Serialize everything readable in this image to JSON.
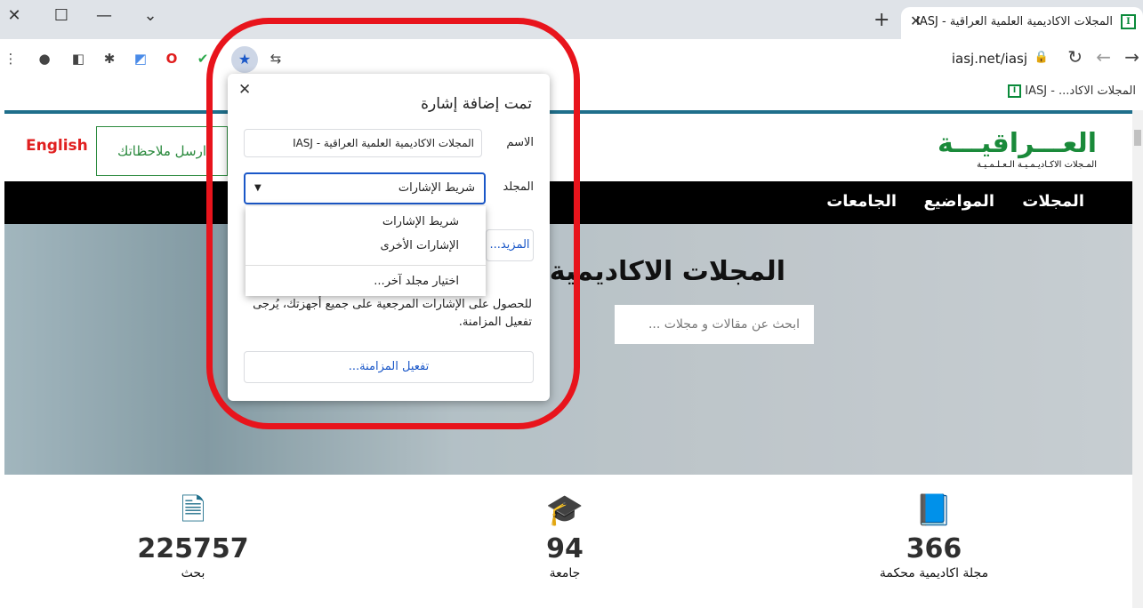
{
  "browser": {
    "tab": {
      "title": "المجلات الاكاديمية العلمية العراقية - IASJ",
      "favicon_letter": "I"
    },
    "url": "iasj.net/iasj",
    "bookmark_item": "المجلات الاكاد... - IASJ",
    "bookmark_favicon_letter": "I"
  },
  "site": {
    "logo_main": "العـــراقيـــة",
    "logo_sub": "المـجلات الاكـاديـمـيـة الـعـلـمـيـة",
    "lang_link": "English",
    "feedback_button": "ارسل ملاحظاتك",
    "nav": [
      "المجلات",
      "المواضيع",
      "الجامعات"
    ],
    "hero_title": "المجلات الاكاديمية",
    "search_placeholder": "ابحث عن مقالات و مجلات ...",
    "stats": [
      {
        "value": "225757",
        "label": "بحث",
        "icon": "document-icon"
      },
      {
        "value": "94",
        "label": "جامعة",
        "icon": "graduation-cap-icon"
      },
      {
        "value": "366",
        "label": "مجلة اكاديمية محكمة",
        "icon": "book-icon"
      }
    ]
  },
  "popup": {
    "title": "تمت إضافة إشارة",
    "name_label": "الاسم",
    "name_value": "المجلات الاكاديمية العلمية العراقية - IASJ",
    "folder_label": "المجلد",
    "folder_value": "شريط الإشارات",
    "more_button": "المزيد...",
    "sync_text": "للحصول على الإشارات المرجعية على جميع أجهزتك، يُرجى تفعيل المزامنة.",
    "sync_button": "تفعيل المزامنة...",
    "dropdown_options": [
      "شريط الإشارات",
      "الإشارات الأخرى",
      "اختيار مجلد آخر..."
    ]
  },
  "colors": {
    "accent": "#1a57c8",
    "brand_green": "#1a8a3a",
    "highlight_red": "#e8141c",
    "icon_teal": "#1f6f8b"
  }
}
